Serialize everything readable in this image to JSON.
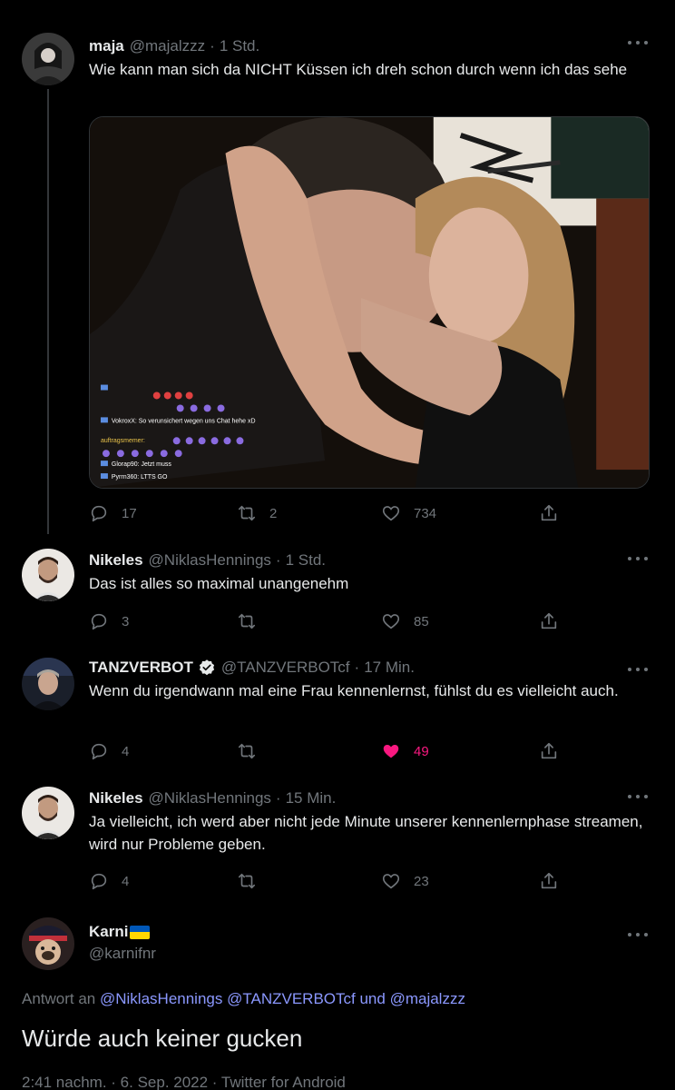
{
  "tweets": [
    {
      "name": "maja",
      "handle": "@majalzzz",
      "time": "1 Std.",
      "text": "Wie kann man sich da NICHT Küssen ich dreh schon durch wenn ich das sehe",
      "replies": "17",
      "retweets": "2",
      "likes": "734",
      "media_overlay": {
        "stream_label": "Glorap90: Jetzt muss",
        "chat_lines": [
          "VokroxX: So verunsichert wegen uns Chat hehe xD",
          "auftragsmemer:",
          "Glorap90: Jetzt muss",
          "Pyrrn360: LTTS GO"
        ]
      }
    },
    {
      "name": "Nikeles",
      "handle": "@NiklasHennings",
      "time": "1 Std.",
      "text": "Das ist alles so maximal unangenehm",
      "replies": "3",
      "retweets": "",
      "likes": "85"
    },
    {
      "name": "TANZVERBOT",
      "handle": "@TANZVERBOTcf",
      "time": "17 Min.",
      "text": "Wenn du irgendwann mal eine Frau kennenlernst, fühlst du es vielleicht auch.",
      "replies": "4",
      "retweets": "",
      "likes": "49",
      "verified": true,
      "liked": true
    },
    {
      "name": "Nikeles",
      "handle": "@NiklasHennings",
      "time": "15 Min.",
      "text": "Ja vielleicht, ich werd aber nicht jede Minute unserer kennenlernphase streamen, wird nur Probleme geben.",
      "replies": "4",
      "retweets": "",
      "likes": "23"
    }
  ],
  "main": {
    "name": "Karni",
    "handle": "@karnifnr",
    "reply_prefix": "Antwort an",
    "mentions": [
      "@NiklasHennings",
      "@TANZVERBOTcf"
    ],
    "reply_and": "und",
    "last_mention": "@majalzzz",
    "text": "Würde auch keiner gucken",
    "meta": "2:41 nachm. · 6. Sep. 2022 · Twitter for Android"
  },
  "colors": {
    "background": "#000000",
    "text": "#e7e9ea",
    "muted": "#71767b",
    "like": "#f91880",
    "link": "#8b98ff"
  },
  "icons": [
    "reply-icon",
    "retweet-icon",
    "like-icon",
    "share-icon",
    "more-icon",
    "verified-icon",
    "ukraine-flag-icon"
  ]
}
